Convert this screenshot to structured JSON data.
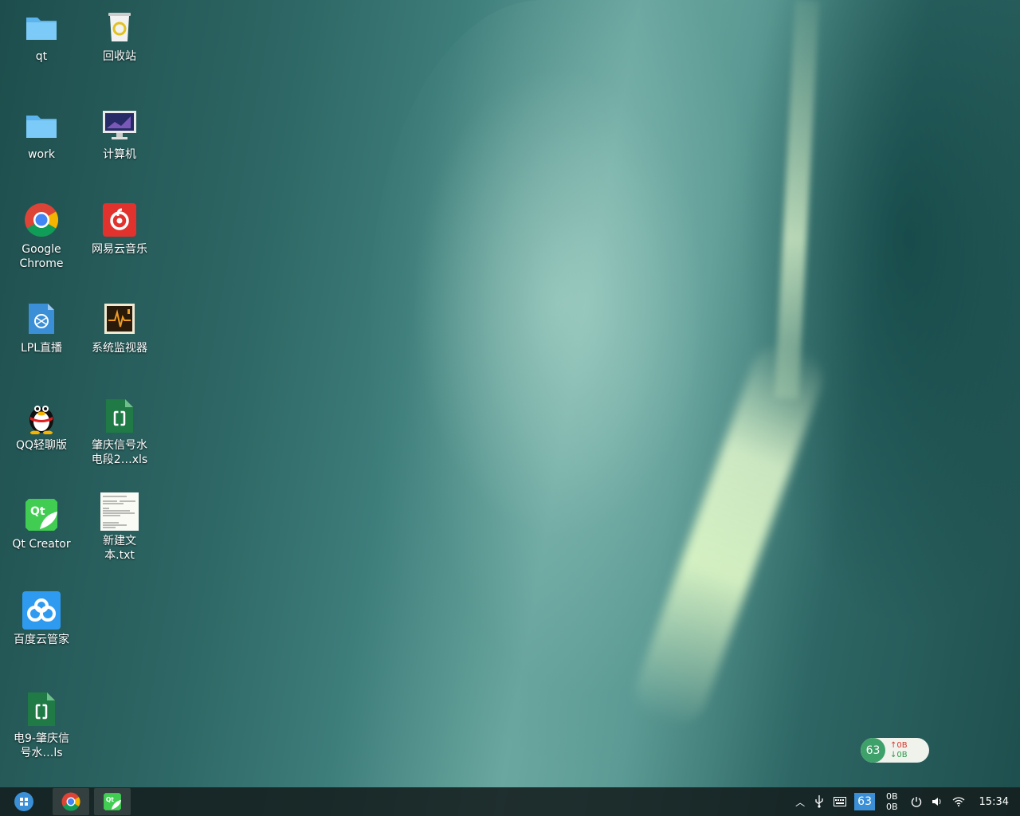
{
  "desktop": {
    "icons": [
      {
        "label": "qt",
        "icon": "folder-icon"
      },
      {
        "label": "回收站",
        "icon": "trash-icon"
      },
      {
        "label": "work",
        "icon": "folder-icon"
      },
      {
        "label": "计算机",
        "icon": "computer-icon"
      },
      {
        "label": "Google\nChrome",
        "icon": "chrome-icon"
      },
      {
        "label": "网易云音乐",
        "icon": "netease-music-icon"
      },
      {
        "label": "LPL直播",
        "icon": "lpl-live-icon"
      },
      {
        "label": "系统监视器",
        "icon": "system-monitor-icon"
      },
      {
        "label": "QQ轻聊版",
        "icon": "qq-icon"
      },
      {
        "label": "肇庆信号水\n电段2…xls",
        "icon": "spreadsheet-icon"
      },
      {
        "label": "Qt Creator",
        "icon": "qt-creator-icon"
      },
      {
        "label": "新建文\n本.txt",
        "icon": "text-file-icon"
      },
      {
        "label": "百度云管家",
        "icon": "baidu-cloud-icon"
      },
      {
        "label": "电9-肇庆信\n号水…ls",
        "icon": "spreadsheet-icon"
      }
    ]
  },
  "net_widget": {
    "cpu": "63",
    "upload": "↑0B",
    "download": "↓0B"
  },
  "taskbar": {
    "launcher": "launcher-icon",
    "apps": [
      "chrome-icon",
      "qt-creator-icon"
    ],
    "tray": {
      "badge": "63",
      "net_up": "0B",
      "net_down": "0B",
      "time": "15:34"
    }
  },
  "colors": {
    "accent": "#3a8fd6",
    "net_green": "#3fa16a",
    "upload_red": "#d9342b"
  }
}
